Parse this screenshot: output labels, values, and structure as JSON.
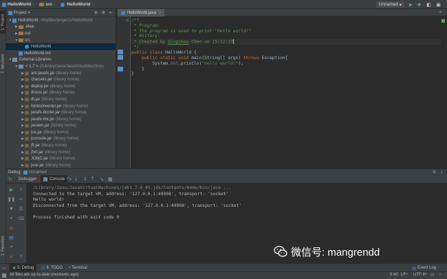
{
  "breadcrumbs": [
    "HelloWorld",
    "src",
    "HelloWorld"
  ],
  "run_config": "Unnamed",
  "left_tabs": [
    "1: Project",
    "7: Structure",
    "2: Favorites"
  ],
  "project_panel": {
    "selector": "Project",
    "tree": [
      {
        "label": "HelloWorld",
        "extra": "~/myfiles/projects/HelloWorld",
        "indent": 0,
        "kind": "module",
        "twisty": "▼"
      },
      {
        "label": ".idea",
        "extra": "",
        "indent": 1,
        "kind": "folder",
        "twisty": "▶"
      },
      {
        "label": "out",
        "extra": "",
        "indent": 1,
        "kind": "folder",
        "twisty": "▶"
      },
      {
        "label": "src",
        "extra": "",
        "indent": 1,
        "kind": "folder",
        "twisty": "▼"
      },
      {
        "label": "HelloWorld",
        "extra": "",
        "indent": 2,
        "kind": "class",
        "twisty": "",
        "selected": true
      },
      {
        "label": "HelloWorld.iml",
        "extra": "",
        "indent": 1,
        "kind": "file",
        "twisty": ""
      },
      {
        "label": "External Libraries",
        "extra": "",
        "indent": 0,
        "kind": "lib",
        "twisty": "▼"
      },
      {
        "label": "< 1.7 >",
        "extra": "(/Library/Java/JavaVirtualMachines",
        "indent": 1,
        "kind": "lib",
        "twisty": "▼"
      },
      {
        "label": "ant-javafx.jar",
        "extra": "(library home)",
        "indent": 2,
        "kind": "jar",
        "twisty": "▶"
      },
      {
        "label": "charsets.jar",
        "extra": "(library home)",
        "indent": 2,
        "kind": "jar",
        "twisty": "▶"
      },
      {
        "label": "deploy.jar",
        "extra": "(library home)",
        "indent": 2,
        "kind": "jar",
        "twisty": "▶"
      },
      {
        "label": "dnsns.jar",
        "extra": "(library home)",
        "indent": 2,
        "kind": "jar",
        "twisty": "▶"
      },
      {
        "label": "dt.jar",
        "extra": "(library home)",
        "indent": 2,
        "kind": "jar",
        "twisty": "▶"
      },
      {
        "label": "htmlconverter.jar",
        "extra": "(library home)",
        "indent": 2,
        "kind": "jar",
        "twisty": "▶"
      },
      {
        "label": "javafx-doclet.jar",
        "extra": "(library home)",
        "indent": 2,
        "kind": "jar",
        "twisty": "▶"
      },
      {
        "label": "javafx-mx.jar",
        "extra": "(library home)",
        "indent": 2,
        "kind": "jar",
        "twisty": "▶"
      },
      {
        "label": "javaws.jar",
        "extra": "(library home)",
        "indent": 2,
        "kind": "jar",
        "twisty": "▶"
      },
      {
        "label": "jce.jar",
        "extra": "(library home)",
        "indent": 2,
        "kind": "jar",
        "twisty": "▶"
      },
      {
        "label": "jconsole.jar",
        "extra": "(library home)",
        "indent": 2,
        "kind": "jar",
        "twisty": "▶"
      },
      {
        "label": "jfr.jar",
        "extra": "(library home)",
        "indent": 2,
        "kind": "jar",
        "twisty": "▶"
      },
      {
        "label": "jfxrt.jar",
        "extra": "(library home)",
        "indent": 2,
        "kind": "jar",
        "twisty": "▶"
      },
      {
        "label": "JObjC.jar",
        "extra": "(library home)",
        "indent": 2,
        "kind": "jar",
        "twisty": "▶"
      },
      {
        "label": "jsse.jar",
        "extra": "(library home)",
        "indent": 2,
        "kind": "jar",
        "twisty": "▶"
      }
    ]
  },
  "editor": {
    "tab": "HelloWorld.java",
    "lines": [
      [
        {
          "t": "/**",
          "c": "cm"
        }
      ],
      [
        {
          "t": " * Program:",
          "c": "cm"
        }
      ],
      [
        {
          "t": " * The program is used to print \"Hello world!\"",
          "c": "cm"
        }
      ],
      [
        {
          "t": " * History:",
          "c": "cm"
        }
      ],
      [
        {
          "t": " * Created by ",
          "c": "cm"
        },
        {
          "t": "Qingshou",
          "c": "cm"
        },
        {
          "t": " Chen on 15/12/23",
          "c": "cm"
        }
      ],
      [
        {
          "t": " */",
          "c": "cm"
        }
      ],
      [
        {
          "t": "public class ",
          "c": "kw"
        },
        {
          "t": "HelloWorld {",
          "c": ""
        }
      ],
      [
        {
          "t": "    ",
          "c": ""
        },
        {
          "t": "public static void ",
          "c": "kw"
        },
        {
          "t": "main(String[] args) ",
          "c": ""
        },
        {
          "t": "throws ",
          "c": "kw"
        },
        {
          "t": "Exception{",
          "c": ""
        }
      ],
      [
        {
          "t": "        System.",
          "c": ""
        },
        {
          "t": "out",
          "c": "fld"
        },
        {
          "t": ".println(",
          "c": ""
        },
        {
          "t": "\"Hello world!\"",
          "c": "st"
        },
        {
          "t": ");",
          "c": ""
        }
      ],
      [
        {
          "t": "    }",
          "c": ""
        }
      ],
      [
        {
          "t": "}",
          "c": ""
        }
      ]
    ]
  },
  "debug": {
    "label": "Debug",
    "config": "Unnamed",
    "tab_debugger": "Debugger",
    "tab_console": "Console",
    "console_lines": [
      "/Library/Java/JavaVirtualMachines/jdk1.7.0_45.jdk/Contents/Home/bin/java ...",
      "Connected to the target VM, address: '127.0.0.1:49908', transport: 'socket'",
      "Hello world!",
      "Disconnected from the target VM, address: '127.0.0.1:49908', transport: 'socket'",
      "",
      "Process finished with exit code 0"
    ]
  },
  "bottom_tabs": [
    "5: Debug",
    "6: TODO",
    "Terminal"
  ],
  "event_log": "Event Log",
  "status": {
    "message": "All files are up-to-date (moments ago)",
    "position": "5:40",
    "line_sep": "LF÷",
    "encoding": "UTF-8÷"
  },
  "watermark": "微信号: mangrendd",
  "colors": {
    "comment": "#629755",
    "keyword": "#cc7832",
    "string": "#6a8759",
    "field": "#9876aa"
  }
}
